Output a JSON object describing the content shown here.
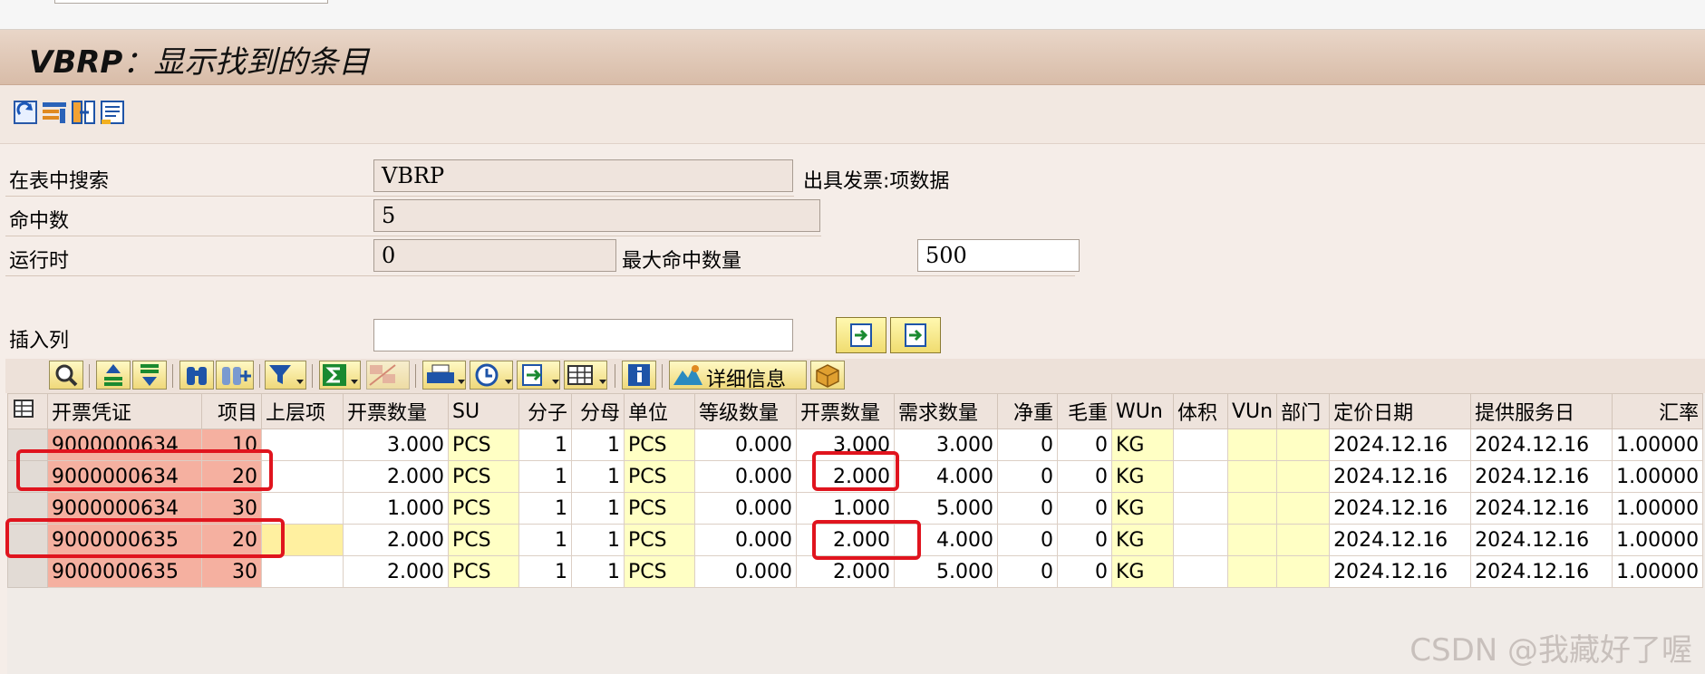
{
  "window": {
    "title_code": "VBRP",
    "title_text": "：显示找到的条目"
  },
  "app_toolbar": {
    "icons": [
      "refresh-icon",
      "table-settings-icon",
      "column-select-icon",
      "list-icon"
    ]
  },
  "form": {
    "search_table_label": "在表中搜索",
    "search_table_value": "VBRP",
    "search_table_desc": "出具发票:项数据",
    "hits_label": "命中数",
    "hits_value": "5",
    "runtime_label": "运行时",
    "runtime_value": "0",
    "max_hits_label": "最大命中数量",
    "max_hits_value": "500",
    "insert_col_label": "插入列",
    "insert_col_value": ""
  },
  "alv_toolbar": {
    "detail_label": "详细信息"
  },
  "columns": [
    "开票凭证",
    "项目",
    "上层项",
    "开票数量",
    "SU",
    "分子",
    "分母",
    "单位",
    "等级数量",
    "开票数量",
    "需求数量",
    "净重",
    "毛重",
    "WUn",
    "体积",
    "VUn",
    "部门",
    "定价日期",
    "提供服务日",
    "汇率"
  ],
  "rows": [
    [
      "9000000634",
      "10",
      "",
      "3.000",
      "PCS",
      "1",
      "1",
      "PCS",
      "0.000",
      "3.000",
      "3.000",
      "0",
      "0",
      "KG",
      "",
      "",
      "",
      "2024.12.16",
      "2024.12.16",
      "1.00000"
    ],
    [
      "9000000634",
      "20",
      "",
      "2.000",
      "PCS",
      "1",
      "1",
      "PCS",
      "0.000",
      "2.000",
      "4.000",
      "0",
      "0",
      "KG",
      "",
      "",
      "",
      "2024.12.16",
      "2024.12.16",
      "1.00000"
    ],
    [
      "9000000634",
      "30",
      "",
      "1.000",
      "PCS",
      "1",
      "1",
      "PCS",
      "0.000",
      "1.000",
      "5.000",
      "0",
      "0",
      "KG",
      "",
      "",
      "",
      "2024.12.16",
      "2024.12.16",
      "1.00000"
    ],
    [
      "9000000635",
      "20",
      "",
      "2.000",
      "PCS",
      "1",
      "1",
      "PCS",
      "0.000",
      "2.000",
      "4.000",
      "0",
      "0",
      "KG",
      "",
      "",
      "",
      "2024.12.16",
      "2024.12.16",
      "1.00000"
    ],
    [
      "9000000635",
      "30",
      "",
      "2.000",
      "PCS",
      "1",
      "1",
      "PCS",
      "0.000",
      "2.000",
      "5.000",
      "0",
      "0",
      "KG",
      "",
      "",
      "",
      "2024.12.16",
      "2024.12.16",
      "1.00000"
    ]
  ],
  "watermark": "CSDN @我藏好了喔",
  "colors": {
    "key_column": "#f5b0a0",
    "currency_column": "#ffffc4",
    "highlight": "#e0141e"
  }
}
